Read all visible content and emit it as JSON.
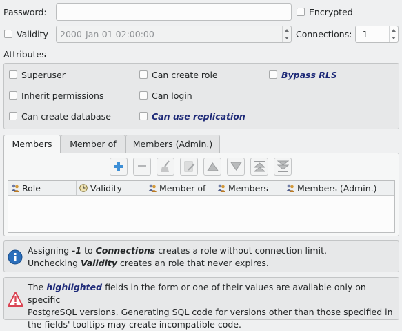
{
  "password": {
    "label": "Password:",
    "value": ""
  },
  "encrypted": {
    "label": "Encrypted"
  },
  "validity": {
    "label": "Validity",
    "value": "2000-Jan-01 02:00:00"
  },
  "connections": {
    "label": "Connections:",
    "value": "-1"
  },
  "attributes": {
    "title": "Attributes",
    "superuser": "Superuser",
    "can_create_role": "Can create role",
    "bypass_rls": "Bypass RLS",
    "inherit_permissions": "Inherit permissions",
    "can_login": "Can login",
    "can_create_database": "Can create database",
    "can_use_replication": "Can use replication"
  },
  "tabs": [
    "Members",
    "Member of",
    "Members (Admin.)"
  ],
  "toolbar": [
    "add-icon",
    "remove-icon",
    "clear-icon",
    "edit-icon",
    "move-up-icon",
    "move-down-icon",
    "move-top-icon",
    "move-bottom-icon"
  ],
  "table": {
    "columns": [
      "Role",
      "Validity",
      "Member of",
      "Members",
      "Members (Admin.)"
    ]
  },
  "info": {
    "l1a": "Assigning ",
    "l1b": "-1",
    "l1c": " to ",
    "l1d": "Connections",
    "l1e": " creates a role without connection limit.",
    "l2a": "Unchecking ",
    "l2b": "Validity",
    "l2c": " creates an role that never expires."
  },
  "warning": {
    "l1a": "The ",
    "l1b": "highlighted",
    "l1c": " fields in the form or one of their values are available only on specific",
    "l2": "PostgreSQL versions. Generating SQL code for versions other than those specified in",
    "l3": "the fields' tooltips may create incompatible code."
  },
  "colors": {
    "highlight": "#1e2a78",
    "info_blue": "#2a6ebb",
    "warning_red": "#da4453",
    "add_blue": "#3d8fd6"
  }
}
